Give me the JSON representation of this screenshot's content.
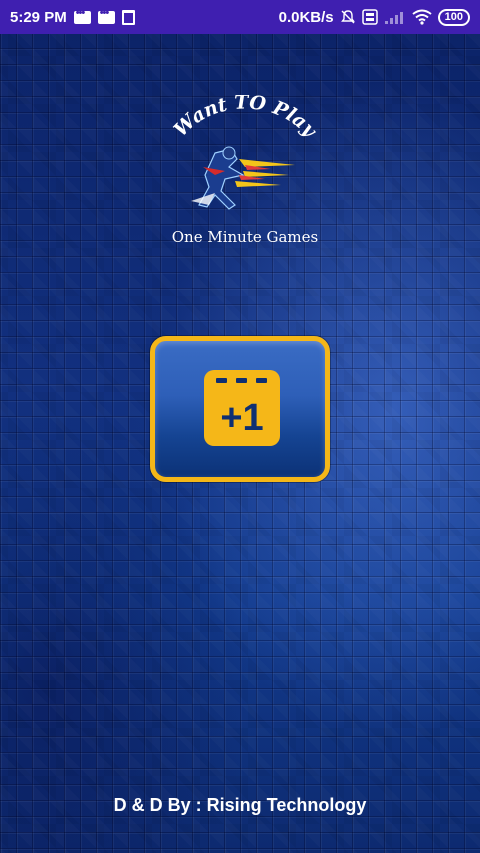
{
  "status_bar": {
    "time": "5:29 PM",
    "network_speed": "0.0KB/s",
    "battery": "100",
    "icons": [
      "message-icon",
      "message-icon",
      "trash-icon",
      "mute-bell-icon",
      "volte-icon",
      "signal-icon",
      "wifi-icon",
      "battery-icon"
    ]
  },
  "logo": {
    "arc_text": "Want TO Play",
    "subtitle": "One Minute Games",
    "icon": "runner-icon"
  },
  "main_button": {
    "icon": "calendar-plus-one-icon",
    "icon_text": "+1"
  },
  "footer": {
    "credit": "D & D By : Rising Technology"
  },
  "colors": {
    "status_bar": "#3f1fb0",
    "accent": "#f5b718",
    "background": "#12307f"
  }
}
